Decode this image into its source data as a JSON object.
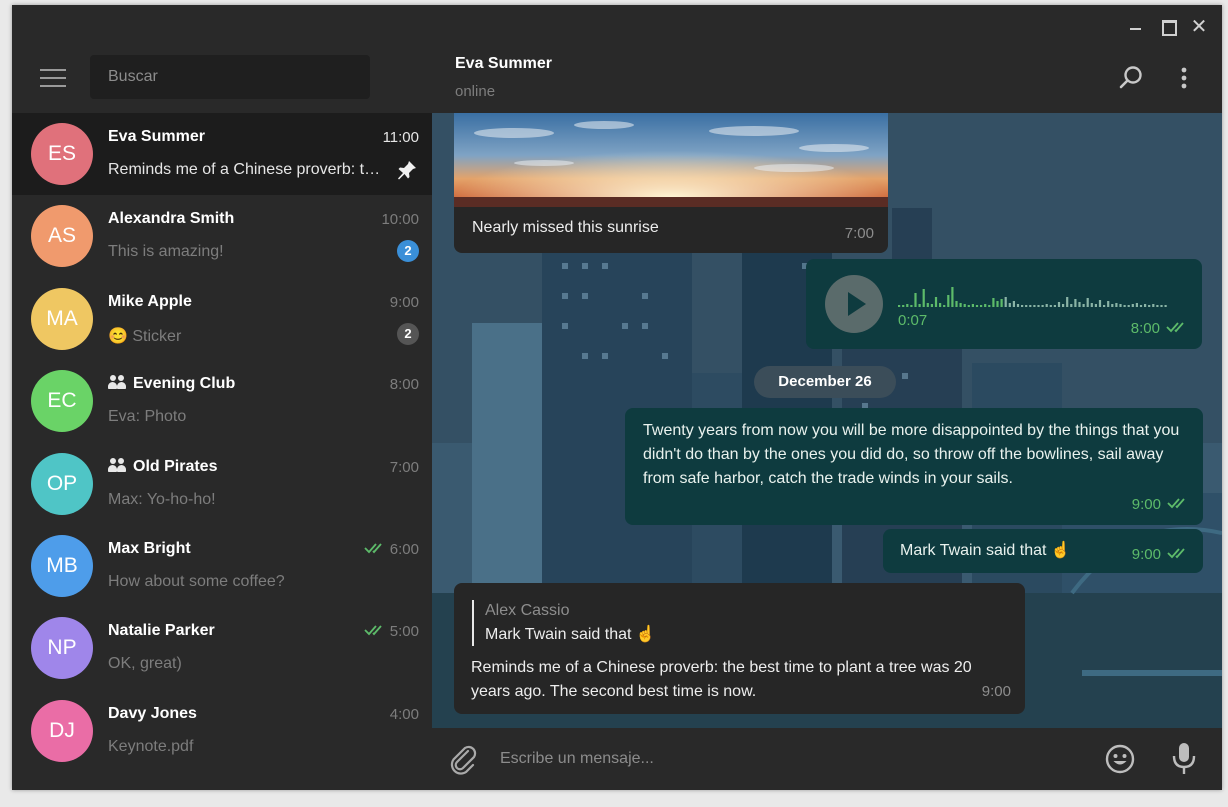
{
  "window": {
    "controls": [
      "minimize",
      "maximize",
      "close"
    ],
    "close_glyph": "✕"
  },
  "sidebar": {
    "search_placeholder": "Buscar",
    "chats": [
      {
        "initials": "ES",
        "name": "Eva Summer",
        "time": "11:00",
        "preview": "Reminds me of a Chinese proverb: the best time to plant a tree",
        "color": "#e0717b",
        "active": true,
        "pinned": true,
        "group": false,
        "unread": null,
        "read": false
      },
      {
        "initials": "AS",
        "name": "Alexandra Smith",
        "time": "10:00",
        "preview": "This is amazing!",
        "color": "#f09a6d",
        "active": false,
        "pinned": false,
        "group": false,
        "unread": "2",
        "unread_color": "#3a8fd8",
        "read": false
      },
      {
        "initials": "MA",
        "name": "Mike Apple",
        "time": "9:00",
        "preview": "😊 Sticker",
        "color": "#efc762",
        "active": false,
        "pinned": false,
        "group": false,
        "unread": "2",
        "unread_color": "#555555",
        "read": false
      },
      {
        "initials": "EC",
        "name": "Evening Club",
        "time": "8:00",
        "preview": "Eva: Photo",
        "color": "#6ad367",
        "active": false,
        "pinned": false,
        "group": true,
        "unread": null,
        "read": false
      },
      {
        "initials": "OP",
        "name": "Old Pirates",
        "time": "7:00",
        "preview": "Max: Yo-ho-ho!",
        "color": "#4fc5c6",
        "active": false,
        "pinned": false,
        "group": true,
        "unread": null,
        "read": false
      },
      {
        "initials": "MB",
        "name": "Max Bright",
        "time": "6:00",
        "preview": "How about some coffee?",
        "color": "#4e9dea",
        "active": false,
        "pinned": false,
        "group": false,
        "unread": null,
        "read": true
      },
      {
        "initials": "NP",
        "name": "Natalie Parker",
        "time": "5:00",
        "preview": "OK, great)",
        "color": "#9f86ea",
        "active": false,
        "pinned": false,
        "group": false,
        "unread": null,
        "read": true
      },
      {
        "initials": "DJ",
        "name": "Davy Jones",
        "time": "4:00",
        "preview": "Keynote.pdf",
        "color": "#ea6da6",
        "active": false,
        "pinned": false,
        "group": false,
        "unread": null,
        "read": false
      }
    ]
  },
  "chat": {
    "peer_name": "Eva Summer",
    "peer_status": "online",
    "messages": {
      "photo": {
        "caption": "Nearly missed this sunrise",
        "time": "7:00"
      },
      "voice": {
        "duration": "0:07",
        "time": "8:00"
      },
      "date_separator": "December 26",
      "quote": {
        "text": "Twenty years from now you will be more disappointed by the things that you didn't do than by the ones you did do, so throw off the bowlines, sail away from safe harbor, catch the trade winds in your sails.",
        "time": "9:00"
      },
      "twain": {
        "text": "Mark Twain said that ☝",
        "time": "9:00"
      },
      "reply": {
        "reply_author": "Alex Cassio",
        "reply_text": "Mark Twain said that ☝",
        "text": "Reminds me of a Chinese proverb: the best time to plant a tree was 20 years ago. The second best time is now.",
        "time": "9:00"
      }
    },
    "composer_placeholder": "Escribe un mensaje..."
  },
  "colors": {
    "accent_green": "#5dbb6a",
    "outgoing_bubble": "#0e3b3f",
    "incoming_bubble": "#262626",
    "sidebar_bg": "#292929"
  },
  "icons": [
    "menu-icon",
    "search-icon",
    "more-icon",
    "pin-icon",
    "group-icon",
    "double-check-icon",
    "play-icon",
    "attach-icon",
    "emoji-icon",
    "mic-icon"
  ]
}
